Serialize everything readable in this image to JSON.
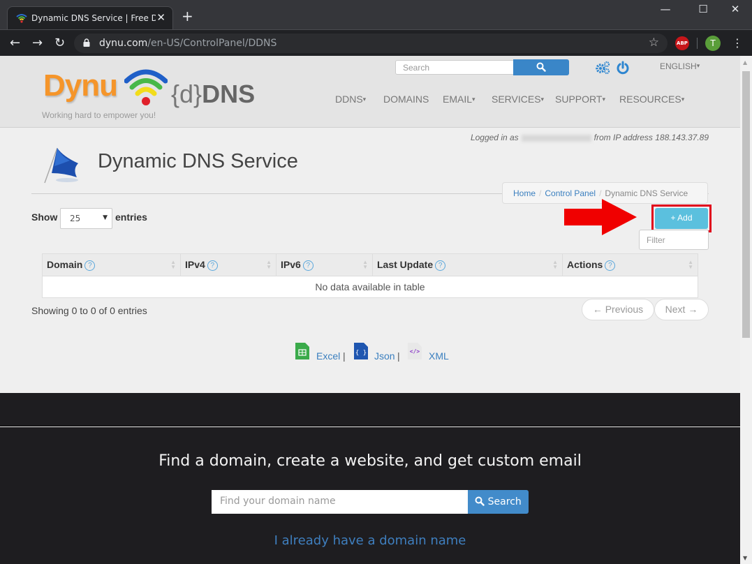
{
  "browser": {
    "tab_title": "Dynamic DNS Service | Free DDNS",
    "url_host": "dynu.com",
    "url_path": "/en-US/ControlPanel/DDNS",
    "abp_label": "ABP",
    "profile_initial": "T",
    "window_controls": {
      "minimize": "—",
      "maximize": "☐",
      "close": "✕"
    },
    "icons": {
      "back": "←",
      "forward": "→",
      "reload": "↻",
      "star": "☆",
      "menu": "⋮",
      "new_tab": "+",
      "tab_close": "✕"
    }
  },
  "header": {
    "logo_text": "Dynu",
    "logo_ddns_brace": "{d}",
    "logo_ddns_text": "DNS",
    "tagline": "Working hard to empower you!",
    "search_placeholder": "Search",
    "language": "ENGLISH",
    "nav": [
      {
        "label": "DDNS",
        "dropdown": true
      },
      {
        "label": "DOMAINS",
        "dropdown": false
      },
      {
        "label": "EMAIL",
        "dropdown": true
      },
      {
        "label": "SERVICES",
        "dropdown": true
      },
      {
        "label": "SUPPORT",
        "dropdown": true
      },
      {
        "label": "RESOURCES",
        "dropdown": true
      }
    ],
    "caret": "▾"
  },
  "session": {
    "logged_in_prefix": "Logged in as",
    "ip_text": "from IP address 188.143.37.89"
  },
  "page": {
    "title": "Dynamic DNS Service",
    "breadcrumb": [
      {
        "label": "Home",
        "link": true
      },
      {
        "label": "Control Panel",
        "link": true
      },
      {
        "label": "Dynamic DNS Service",
        "link": false
      }
    ],
    "breadcrumb_sep": "/"
  },
  "table_controls": {
    "show_label": "Show",
    "entries_value": "25",
    "entries_label": "entries",
    "add_label": "+ Add",
    "filter_placeholder": "Filter",
    "annotation_color": "#e0001b"
  },
  "table": {
    "columns": [
      "Domain",
      "IPv4",
      "IPv6",
      "Last Update",
      "Actions"
    ],
    "help_glyph": "?",
    "empty_message": "No data available in table",
    "info": "Showing 0 to 0 of 0 entries",
    "prev_label": "← Previous",
    "next_label": "Next →"
  },
  "export": {
    "items": [
      "Excel",
      "Json",
      "XML"
    ],
    "sep": "|"
  },
  "footer": {
    "title": "Find a domain, create a website, and get custom email",
    "domain_placeholder": "Find your domain name",
    "search_label": "Search",
    "have_domain_link": "I already have a domain name"
  }
}
